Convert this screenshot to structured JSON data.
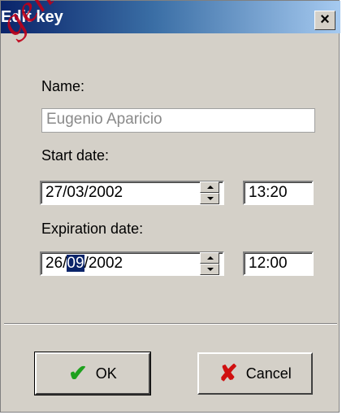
{
  "window": {
    "title": "Edit key",
    "close_symbol": "×"
  },
  "name": {
    "label": "Name:",
    "value": "Eugenio Aparicio"
  },
  "start": {
    "label": "Start date:",
    "date": "27/03/2002",
    "time": "13:20"
  },
  "expiration": {
    "label": "Expiration date:",
    "date_prefix": "26/",
    "date_selected": "09",
    "date_suffix": "/2002",
    "time": "12:00"
  },
  "buttons": {
    "ok_label": "OK",
    "cancel_label": "Cancel",
    "ok_icon": "checkmark-icon",
    "cancel_icon": "red-x-icon"
  },
  "colors": {
    "title_bar_start": "#0a246a",
    "title_bar_end": "#a6caf0",
    "dialog_bg": "#d4d0c8",
    "ok_check": "#1ea11e",
    "cancel_x": "#d01010"
  }
}
